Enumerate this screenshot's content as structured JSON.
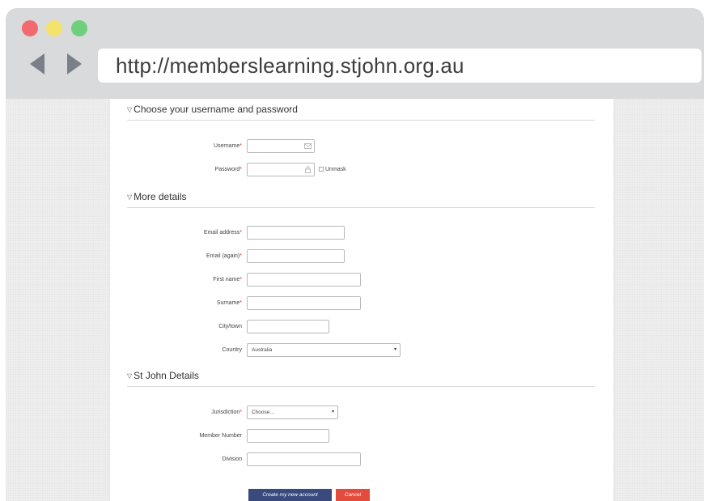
{
  "browser": {
    "url": "http://memberslearning.stjohn.org.au"
  },
  "sections": {
    "account": {
      "title": "Choose your username and password"
    },
    "details": {
      "title": "More details"
    },
    "stjohn": {
      "title": "St John Details"
    }
  },
  "fields": {
    "username": {
      "label": "Username"
    },
    "password": {
      "label": "Password",
      "unmask": "Unmask"
    },
    "email": {
      "label": "Email address"
    },
    "email_again": {
      "label": "Email (again)"
    },
    "first_name": {
      "label": "First name"
    },
    "surname": {
      "label": "Surname"
    },
    "city": {
      "label": "City/town"
    },
    "country": {
      "label": "Country",
      "value": "Australia"
    },
    "jurisdiction": {
      "label": "Jurisdiction",
      "value": "Choose..."
    },
    "member_number": {
      "label": "Member Number"
    },
    "division": {
      "label": "Division"
    }
  },
  "required_marker": "*",
  "buttons": {
    "create": "Create my new account",
    "cancel": "Cancel"
  },
  "colors": {
    "primary_button": "#3a4a7c",
    "cancel_button": "#e34b3d",
    "required": "#c0392b"
  }
}
